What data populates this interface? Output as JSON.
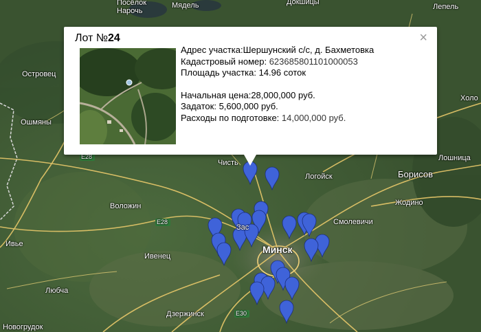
{
  "map": {
    "labels": {
      "poselok_naroch": "Посёлок\nНарочь",
      "myadel": "Мядель",
      "dokshitsy": "Докшицы",
      "lepel": "Лепель",
      "ostrovets": "Островец",
      "oshmyany": "Ошмяны",
      "khotsk": "Холо",
      "chist": "Чисть",
      "logoysk": "Логойск",
      "borisov": "Борисов",
      "loshnitsa": "Лошница",
      "volozhin": "Воложин",
      "zhodino": "Жодино",
      "smolevichi": "Смолевичи",
      "minsk": "Минск",
      "ive": "Ивье",
      "ivenets": "Ивенец",
      "zas": "Зас",
      "lyuba": "Любча",
      "dzerzhinsk": "Дзержинск",
      "novogrudok": "Новогрудок",
      "e28a": "E28",
      "e28b": "E28",
      "e30": "E30"
    }
  },
  "popup": {
    "title_prefix": "Лот №",
    "title_number": "24",
    "address_label": "Адрес участка:",
    "address_value": "Шершунский с/с, д. Бахметовка",
    "cadastral_label": "Кадастровый номер: ",
    "cadastral_value": "623685801101000053",
    "area_label": "Площадь участка: ",
    "area_value": "14.96 соток",
    "price_label": "Начальная цена:",
    "price_value": "28,000,000 руб.",
    "deposit_label": "Задаток: ",
    "deposit_value": "5,600,000 руб.",
    "costs_label": "Расходы по подготовке: ",
    "costs_value": "14,000,000 руб."
  },
  "colors": {
    "marker": "#3f63d9",
    "popup_bg": "#ffffff"
  },
  "icons": {
    "close": "close-icon",
    "marker": "map-pin-icon"
  }
}
